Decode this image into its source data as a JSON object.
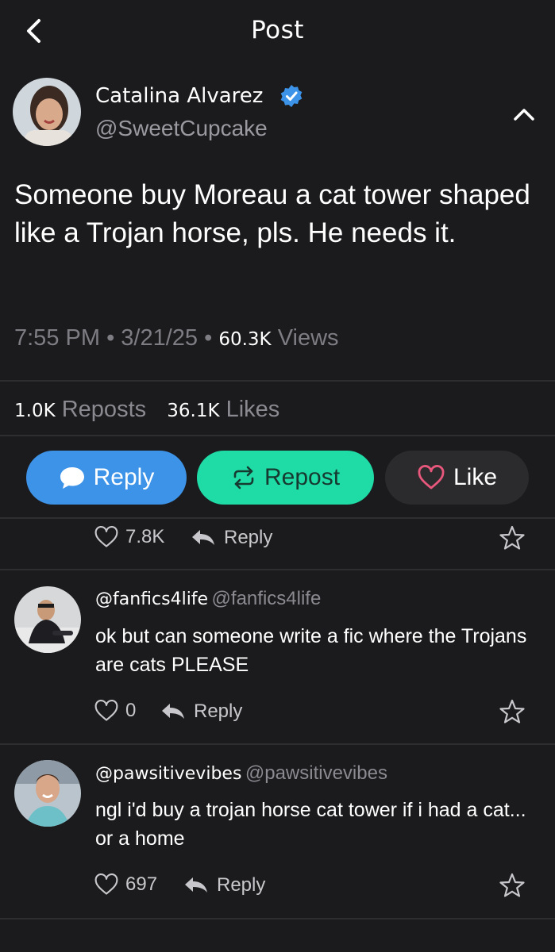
{
  "header": {
    "title": "Post"
  },
  "post": {
    "author_name": "Catalina Alvarez",
    "handle": "@SweetCupcake",
    "text": "Someone buy Moreau a cat tower shaped like a Trojan horse, pls. He needs it.",
    "time": "7:55 PM",
    "date": "3/21/25",
    "views_count": "60.3K",
    "views_label": "Views",
    "reposts_count": "1.0K",
    "reposts_label": "Reposts",
    "likes_count": "36.1K",
    "likes_label": "Likes"
  },
  "actions": {
    "reply": "Reply",
    "repost": "Repost",
    "like": "Like"
  },
  "partial_comment": {
    "likes": "7.8K",
    "reply_label": "Reply"
  },
  "comments": [
    {
      "name": "@fanfics4life",
      "handle": "@fanfics4life",
      "text": "ok but can someone write a fic where the Trojans are cats PLEASE",
      "likes": "0",
      "reply_label": "Reply"
    },
    {
      "name": "@pawsitivevibes",
      "handle": "@pawsitivevibes",
      "text": "ngl i'd buy a trojan horse cat tower if i had a cat... or a home",
      "likes": "697",
      "reply_label": "Reply"
    }
  ],
  "colors": {
    "background": "#1b1b1d",
    "reply_button": "#3d93e8",
    "repost_button": "#1fdba6",
    "like_button": "#2b2b2e",
    "verified_badge": "#3d93e8",
    "like_heart": "#e8577c"
  }
}
